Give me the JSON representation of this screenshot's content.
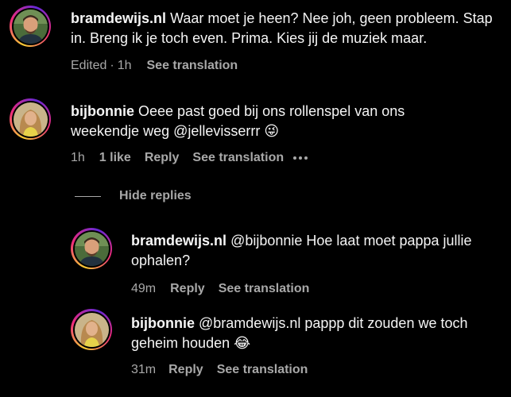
{
  "comments": [
    {
      "username": "bramdewijs.nl",
      "text": "Waar moet je heen? Nee joh, geen probleem. Stap in. Breng ik je toch even. Prima. Kies jij de muziek maar.",
      "edited": "Edited",
      "separator": "·",
      "time": "1h",
      "see_translation": "See translation",
      "avatar_icon": "profile-photo-man"
    },
    {
      "username": "bijbonnie",
      "text": "Oeee past goed bij ons rollenspel van ons weekendje weg @jellevisserrr 😜",
      "time": "1h",
      "likes": "1 like",
      "reply": "Reply",
      "see_translation": "See translation",
      "more_icon": "more-dots-icon",
      "avatar_icon": "profile-photo-woman"
    }
  ],
  "replies_toggle": {
    "label": "Hide replies"
  },
  "replies": [
    {
      "username": "bramdewijs.nl",
      "text": "@bijbonnie Hoe laat moet pappa jullie ophalen?",
      "time": "49m",
      "reply": "Reply",
      "see_translation": "See translation",
      "avatar_icon": "profile-photo-man"
    },
    {
      "username": "bijbonnie",
      "text": "@bramdewijs.nl pappp dit zouden we toch geheim houden 😂",
      "time": "31m",
      "reply": "Reply",
      "see_translation": "See translation",
      "avatar_icon": "profile-photo-woman"
    }
  ],
  "colors": {
    "background": "#000000",
    "primary_text": "#f5f5f5",
    "secondary_text": "#a8a8a8",
    "ring_gradient": [
      "#f9ce34",
      "#ee2a7b",
      "#6228d7"
    ]
  }
}
